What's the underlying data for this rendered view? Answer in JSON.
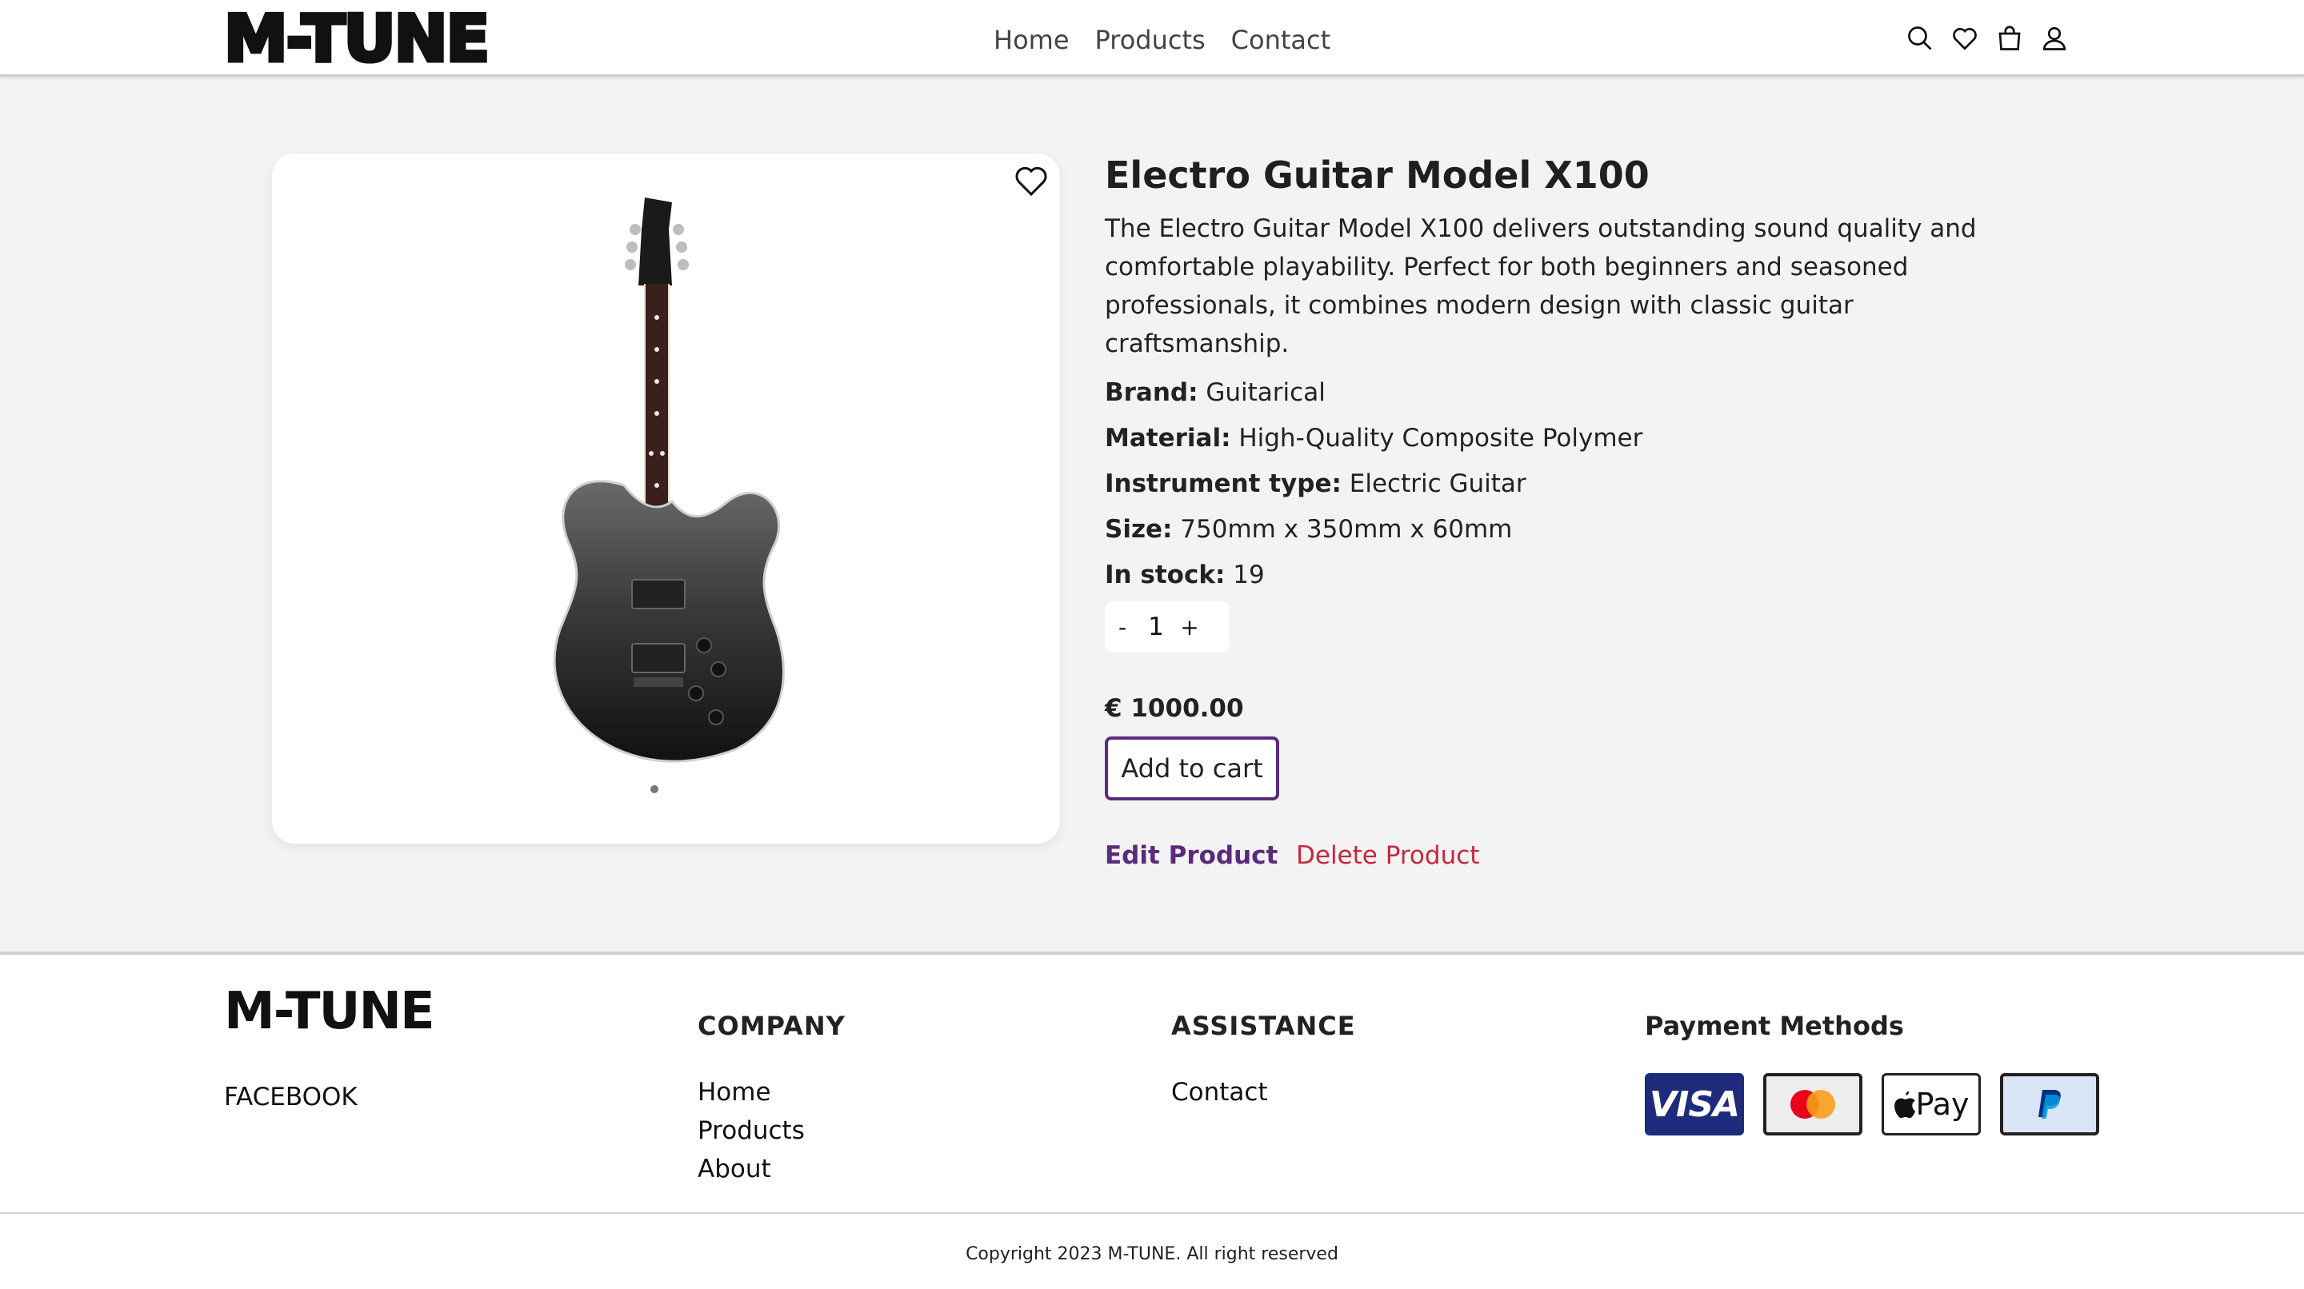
{
  "header": {
    "logo": "M-TUNE",
    "nav": [
      "Home",
      "Products",
      "Contact"
    ],
    "icons": [
      "search-icon",
      "heart-icon",
      "shopping-bag-icon",
      "user-icon"
    ]
  },
  "product": {
    "title": "Electro Guitar Model X100",
    "description": "The Electro Guitar Model X100 delivers outstanding sound quality and comfortable playability. Perfect for both beginners and seasoned professionals, it combines modern design with classic guitar craftsmanship.",
    "specs": [
      {
        "label": "Brand:",
        "value": "Guitarical"
      },
      {
        "label": "Material:",
        "value": "High-Quality Composite Polymer"
      },
      {
        "label": "Instrument type:",
        "value": "Electric Guitar"
      },
      {
        "label": "Size:",
        "value": "750mm x 350mm x 60mm"
      },
      {
        "label": "In stock:",
        "value": "19"
      }
    ],
    "quantity": {
      "minus": "-",
      "value": "1",
      "plus": "+"
    },
    "price": "€ 1000.00",
    "add_to_cart": "Add to cart",
    "edit": "Edit Product",
    "delete": "Delete Product"
  },
  "footer": {
    "logo": "M-TUNE",
    "social": "FACEBOOK",
    "company": {
      "title": "COMPANY",
      "links": [
        "Home",
        "Products",
        "About"
      ]
    },
    "assistance": {
      "title": "ASSISTANCE",
      "links": [
        "Contact"
      ]
    },
    "payment": {
      "title": "Payment Methods",
      "methods": [
        "VISA",
        "Mastercard",
        "Apple Pay",
        "PayPal"
      ],
      "apple_text": "Pay"
    },
    "copyright": "Copyright 2023 M-TUNE. All right reserved"
  },
  "colors": {
    "accent": "#5b2a7d",
    "danger": "#c5283d",
    "background": "#f3f3f3"
  }
}
